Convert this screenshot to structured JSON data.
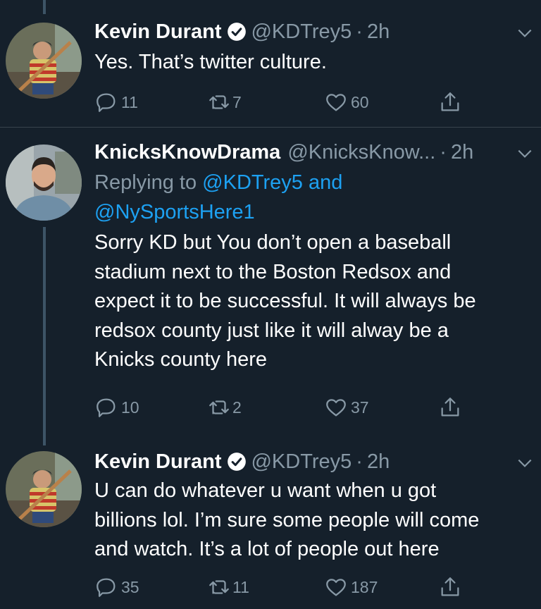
{
  "colors": {
    "background": "#15202b",
    "primary_text": "#ffffff",
    "secondary_text": "#8899a6",
    "link": "#1da1f2",
    "divider": "#38444d",
    "thread_line": "#3d5466"
  },
  "tweets": [
    {
      "name": "Kevin Durant",
      "verified": true,
      "handle": "@KDTrey5",
      "separator": "·",
      "time": "2h",
      "text": "Yes. That’s twitter culture.",
      "replies": "11",
      "retweets": "7",
      "likes": "60"
    },
    {
      "name": "KnicksKnowDrama",
      "verified": false,
      "handle": "@KnicksKnow...",
      "separator": "·",
      "time": "2h",
      "replying_prefix": "Replying to ",
      "replying_mention_1": "@KDTrey5",
      "replying_and": " and",
      "replying_mention_2": "@NySportsHere1",
      "text_lines": [
        "Sorry KD but You don’t open a baseball",
        "stadium next to the Boston Redsox and",
        "expect it to be successful. It will always be",
        "redsox county just like it will alway be a",
        "Knicks county here"
      ],
      "replies": "10",
      "retweets": "2",
      "likes": "37"
    },
    {
      "name": "Kevin Durant",
      "verified": true,
      "handle": "@KDTrey5",
      "separator": "·",
      "time": "2h",
      "text_lines": [
        "U can do whatever u want when u got",
        "billions lol. I’m sure some people will come",
        "and watch. It’s a lot of people out here"
      ],
      "replies": "35",
      "retweets": "11",
      "likes": "187"
    }
  ]
}
